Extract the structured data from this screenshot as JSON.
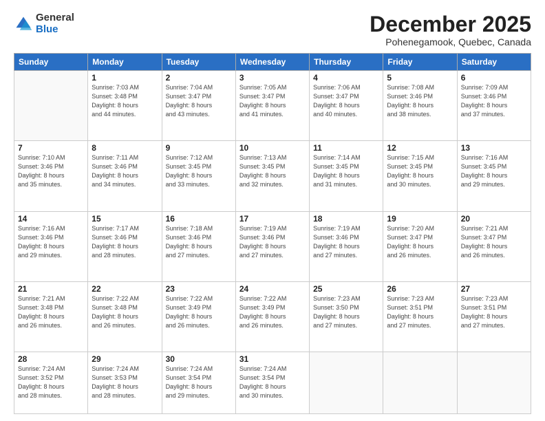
{
  "header": {
    "logo_general": "General",
    "logo_blue": "Blue",
    "month_title": "December 2025",
    "location": "Pohenegamook, Quebec, Canada"
  },
  "weekdays": [
    "Sunday",
    "Monday",
    "Tuesday",
    "Wednesday",
    "Thursday",
    "Friday",
    "Saturday"
  ],
  "weeks": [
    [
      {
        "day": "",
        "info": ""
      },
      {
        "day": "1",
        "info": "Sunrise: 7:03 AM\nSunset: 3:48 PM\nDaylight: 8 hours\nand 44 minutes."
      },
      {
        "day": "2",
        "info": "Sunrise: 7:04 AM\nSunset: 3:47 PM\nDaylight: 8 hours\nand 43 minutes."
      },
      {
        "day": "3",
        "info": "Sunrise: 7:05 AM\nSunset: 3:47 PM\nDaylight: 8 hours\nand 41 minutes."
      },
      {
        "day": "4",
        "info": "Sunrise: 7:06 AM\nSunset: 3:47 PM\nDaylight: 8 hours\nand 40 minutes."
      },
      {
        "day": "5",
        "info": "Sunrise: 7:08 AM\nSunset: 3:46 PM\nDaylight: 8 hours\nand 38 minutes."
      },
      {
        "day": "6",
        "info": "Sunrise: 7:09 AM\nSunset: 3:46 PM\nDaylight: 8 hours\nand 37 minutes."
      }
    ],
    [
      {
        "day": "7",
        "info": "Sunrise: 7:10 AM\nSunset: 3:46 PM\nDaylight: 8 hours\nand 35 minutes."
      },
      {
        "day": "8",
        "info": "Sunrise: 7:11 AM\nSunset: 3:46 PM\nDaylight: 8 hours\nand 34 minutes."
      },
      {
        "day": "9",
        "info": "Sunrise: 7:12 AM\nSunset: 3:45 PM\nDaylight: 8 hours\nand 33 minutes."
      },
      {
        "day": "10",
        "info": "Sunrise: 7:13 AM\nSunset: 3:45 PM\nDaylight: 8 hours\nand 32 minutes."
      },
      {
        "day": "11",
        "info": "Sunrise: 7:14 AM\nSunset: 3:45 PM\nDaylight: 8 hours\nand 31 minutes."
      },
      {
        "day": "12",
        "info": "Sunrise: 7:15 AM\nSunset: 3:45 PM\nDaylight: 8 hours\nand 30 minutes."
      },
      {
        "day": "13",
        "info": "Sunrise: 7:16 AM\nSunset: 3:45 PM\nDaylight: 8 hours\nand 29 minutes."
      }
    ],
    [
      {
        "day": "14",
        "info": "Sunrise: 7:16 AM\nSunset: 3:46 PM\nDaylight: 8 hours\nand 29 minutes."
      },
      {
        "day": "15",
        "info": "Sunrise: 7:17 AM\nSunset: 3:46 PM\nDaylight: 8 hours\nand 28 minutes."
      },
      {
        "day": "16",
        "info": "Sunrise: 7:18 AM\nSunset: 3:46 PM\nDaylight: 8 hours\nand 27 minutes."
      },
      {
        "day": "17",
        "info": "Sunrise: 7:19 AM\nSunset: 3:46 PM\nDaylight: 8 hours\nand 27 minutes."
      },
      {
        "day": "18",
        "info": "Sunrise: 7:19 AM\nSunset: 3:46 PM\nDaylight: 8 hours\nand 27 minutes."
      },
      {
        "day": "19",
        "info": "Sunrise: 7:20 AM\nSunset: 3:47 PM\nDaylight: 8 hours\nand 26 minutes."
      },
      {
        "day": "20",
        "info": "Sunrise: 7:21 AM\nSunset: 3:47 PM\nDaylight: 8 hours\nand 26 minutes."
      }
    ],
    [
      {
        "day": "21",
        "info": "Sunrise: 7:21 AM\nSunset: 3:48 PM\nDaylight: 8 hours\nand 26 minutes."
      },
      {
        "day": "22",
        "info": "Sunrise: 7:22 AM\nSunset: 3:48 PM\nDaylight: 8 hours\nand 26 minutes."
      },
      {
        "day": "23",
        "info": "Sunrise: 7:22 AM\nSunset: 3:49 PM\nDaylight: 8 hours\nand 26 minutes."
      },
      {
        "day": "24",
        "info": "Sunrise: 7:22 AM\nSunset: 3:49 PM\nDaylight: 8 hours\nand 26 minutes."
      },
      {
        "day": "25",
        "info": "Sunrise: 7:23 AM\nSunset: 3:50 PM\nDaylight: 8 hours\nand 27 minutes."
      },
      {
        "day": "26",
        "info": "Sunrise: 7:23 AM\nSunset: 3:51 PM\nDaylight: 8 hours\nand 27 minutes."
      },
      {
        "day": "27",
        "info": "Sunrise: 7:23 AM\nSunset: 3:51 PM\nDaylight: 8 hours\nand 27 minutes."
      }
    ],
    [
      {
        "day": "28",
        "info": "Sunrise: 7:24 AM\nSunset: 3:52 PM\nDaylight: 8 hours\nand 28 minutes."
      },
      {
        "day": "29",
        "info": "Sunrise: 7:24 AM\nSunset: 3:53 PM\nDaylight: 8 hours\nand 28 minutes."
      },
      {
        "day": "30",
        "info": "Sunrise: 7:24 AM\nSunset: 3:54 PM\nDaylight: 8 hours\nand 29 minutes."
      },
      {
        "day": "31",
        "info": "Sunrise: 7:24 AM\nSunset: 3:54 PM\nDaylight: 8 hours\nand 30 minutes."
      },
      {
        "day": "",
        "info": ""
      },
      {
        "day": "",
        "info": ""
      },
      {
        "day": "",
        "info": ""
      }
    ]
  ]
}
